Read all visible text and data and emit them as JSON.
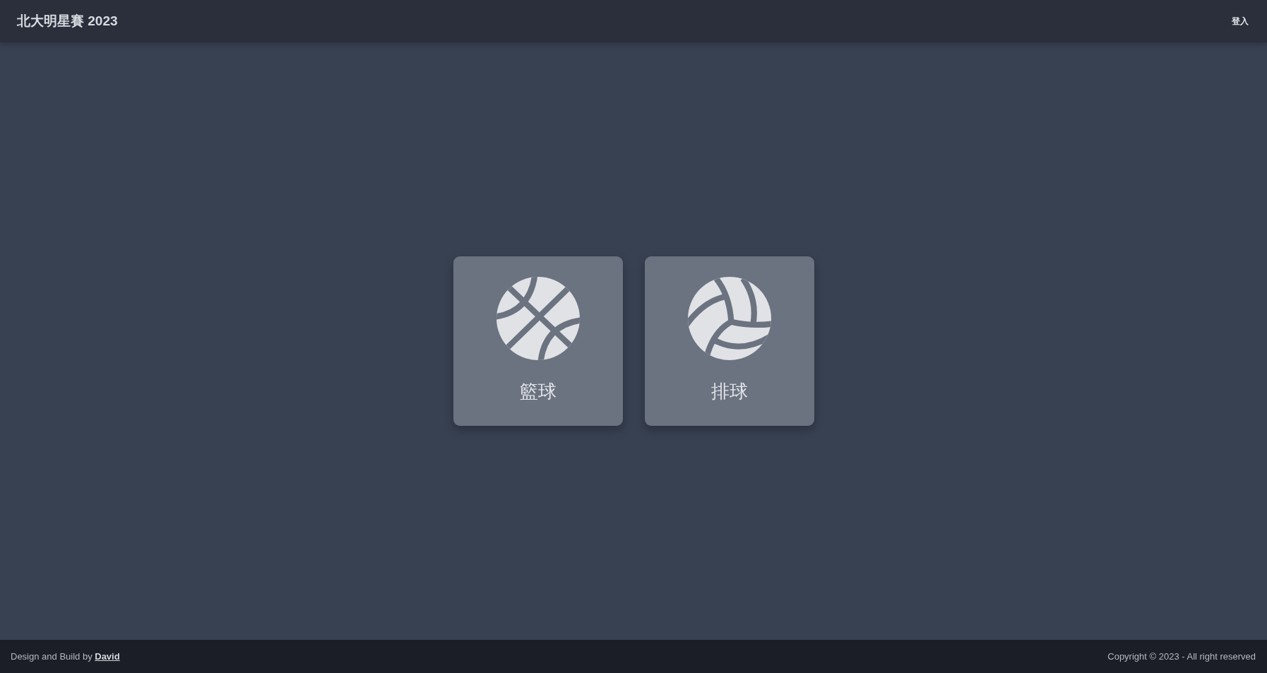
{
  "header": {
    "title": "北大明星賽 2023",
    "login_link": "登入"
  },
  "sports": [
    {
      "kind": "basketball",
      "label": "籃球"
    },
    {
      "kind": "volleyball",
      "label": "排球"
    }
  ],
  "footer": {
    "credit": "Design and Build by",
    "author_link": "David",
    "copyright": "Copyright © 2023 - All right reserved"
  }
}
